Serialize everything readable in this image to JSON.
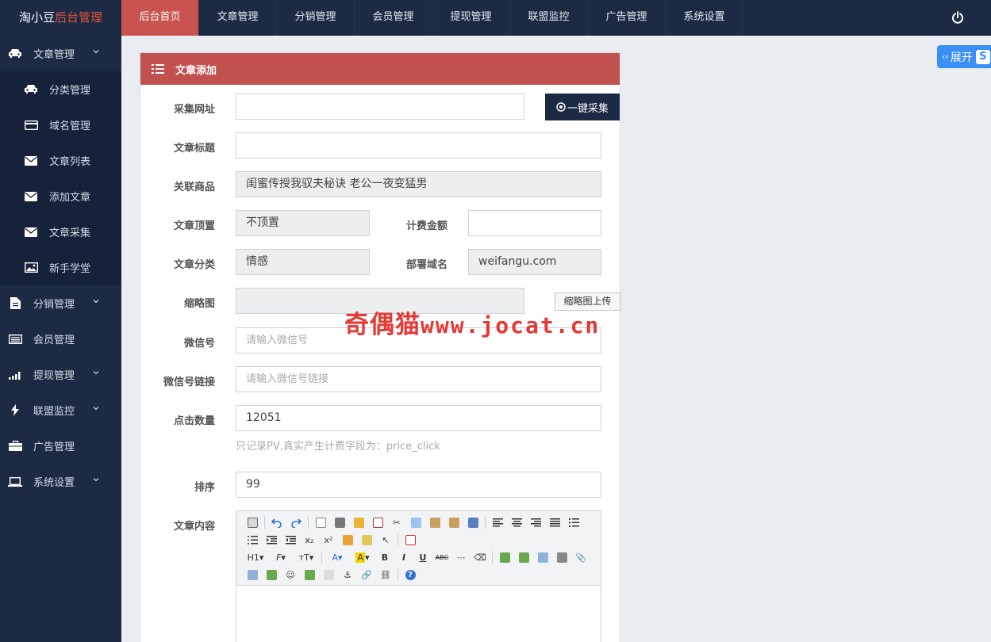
{
  "brand": {
    "name": "淘小豆",
    "accent": "后台管理"
  },
  "topnav": [
    {
      "label": "后台首页",
      "active": true
    },
    {
      "label": "文章管理"
    },
    {
      "label": "分销管理"
    },
    {
      "label": "会员管理"
    },
    {
      "label": "提现管理"
    },
    {
      "label": "联盟监控"
    },
    {
      "label": "广告管理"
    },
    {
      "label": "系统设置"
    }
  ],
  "sidebar": {
    "article_group": "文章管理",
    "article_items": [
      "分类管理",
      "域名管理",
      "文章列表",
      "添加文章",
      "文章采集",
      "新手学堂"
    ],
    "groups": [
      "分销管理",
      "会员管理",
      "提现管理",
      "联盟监控",
      "广告管理",
      "系统设置"
    ]
  },
  "panel": {
    "title": "文章添加"
  },
  "form": {
    "collect_url": {
      "label": "采集网址",
      "value": ""
    },
    "collect_button": "一键采集",
    "title": {
      "label": "文章标题",
      "value": ""
    },
    "product": {
      "label": "关联商品",
      "value": "闺蜜传授我驭夫秘诀 老公一夜变猛男"
    },
    "top": {
      "label": "文章顶置",
      "value": "不顶置"
    },
    "fee": {
      "label": "计费金额",
      "value": ""
    },
    "category": {
      "label": "文章分类",
      "value": "情感"
    },
    "domain": {
      "label": "部署域名",
      "value": "weifangu.com"
    },
    "thumb": {
      "label": "缩略图",
      "value": "",
      "button": "缩略图上传"
    },
    "wechat": {
      "label": "微信号",
      "placeholder": "请输入微信号"
    },
    "wechat_link": {
      "label": "微信号链接",
      "placeholder": "请输入微信号链接"
    },
    "clicks": {
      "label": "点击数量",
      "value": "12051",
      "hint": "只记录PV,真实产生计费字段为：price_click"
    },
    "sort": {
      "label": "排序",
      "value": "99"
    },
    "content": {
      "label": "文章内容"
    }
  },
  "expand_button": {
    "label": "展开",
    "logo": "S"
  },
  "watermark": {
    "cn": "奇偶猫",
    "url": "www.jocat.cn"
  },
  "colors": {
    "nav_bg": "#1c2a43",
    "accent": "#c0514f",
    "expand": "#3b8ef3"
  }
}
